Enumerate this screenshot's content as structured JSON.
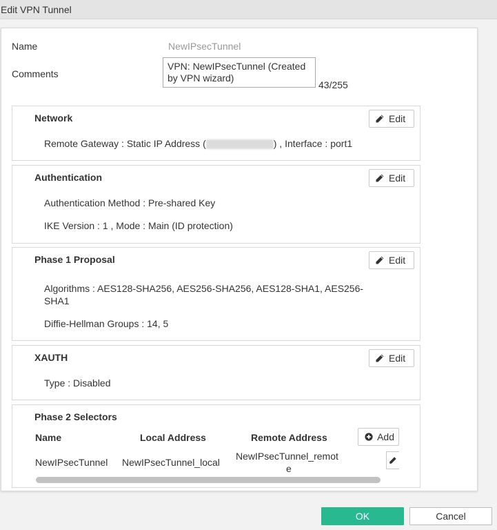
{
  "window": {
    "title": "Edit VPN Tunnel"
  },
  "form": {
    "name_label": "Name",
    "name_value": "NewIPsecTunnel",
    "comments_label": "Comments",
    "comments_value": "VPN: NewIPsecTunnel (Created by VPN wizard)",
    "comments_counter": "43/255"
  },
  "sections": {
    "network": {
      "title": "Network",
      "edit_label": "Edit",
      "remote_gateway_prefix": "Remote Gateway : Static IP Address (",
      "remote_gateway_suffix": ") , Interface : port1"
    },
    "authentication": {
      "title": "Authentication",
      "edit_label": "Edit",
      "method": "Authentication Method : Pre-shared Key",
      "ike": "IKE Version : 1 , Mode : Main (ID protection)"
    },
    "phase1": {
      "title": "Phase 1 Proposal",
      "edit_label": "Edit",
      "algorithms_line1": "Algorithms : AES128-SHA256, AES256-SHA256, AES128-SHA1, AES256-",
      "algorithms_line2": "SHA1",
      "dh_groups": "Diffie-Hellman Groups : 14, 5"
    },
    "xauth": {
      "title": "XAUTH",
      "edit_label": "Edit",
      "type": "Type : Disabled"
    },
    "phase2": {
      "title": "Phase 2 Selectors",
      "add_label": "Add",
      "columns": [
        "Name",
        "Local Address",
        "Remote Address"
      ],
      "rows": [
        {
          "name": "NewIPsecTunnel",
          "local": "NewIPsecTunnel_local",
          "remote_line1": "NewIPsecTunnel_remot",
          "remote_line2": "e"
        }
      ]
    }
  },
  "footer": {
    "ok_label": "OK",
    "cancel_label": "Cancel"
  },
  "colors": {
    "ok_button": "#28b990",
    "title_bar": "#e4e4e4"
  },
  "icons": {
    "edit": "pencil-icon",
    "add": "plus-circle-icon"
  }
}
